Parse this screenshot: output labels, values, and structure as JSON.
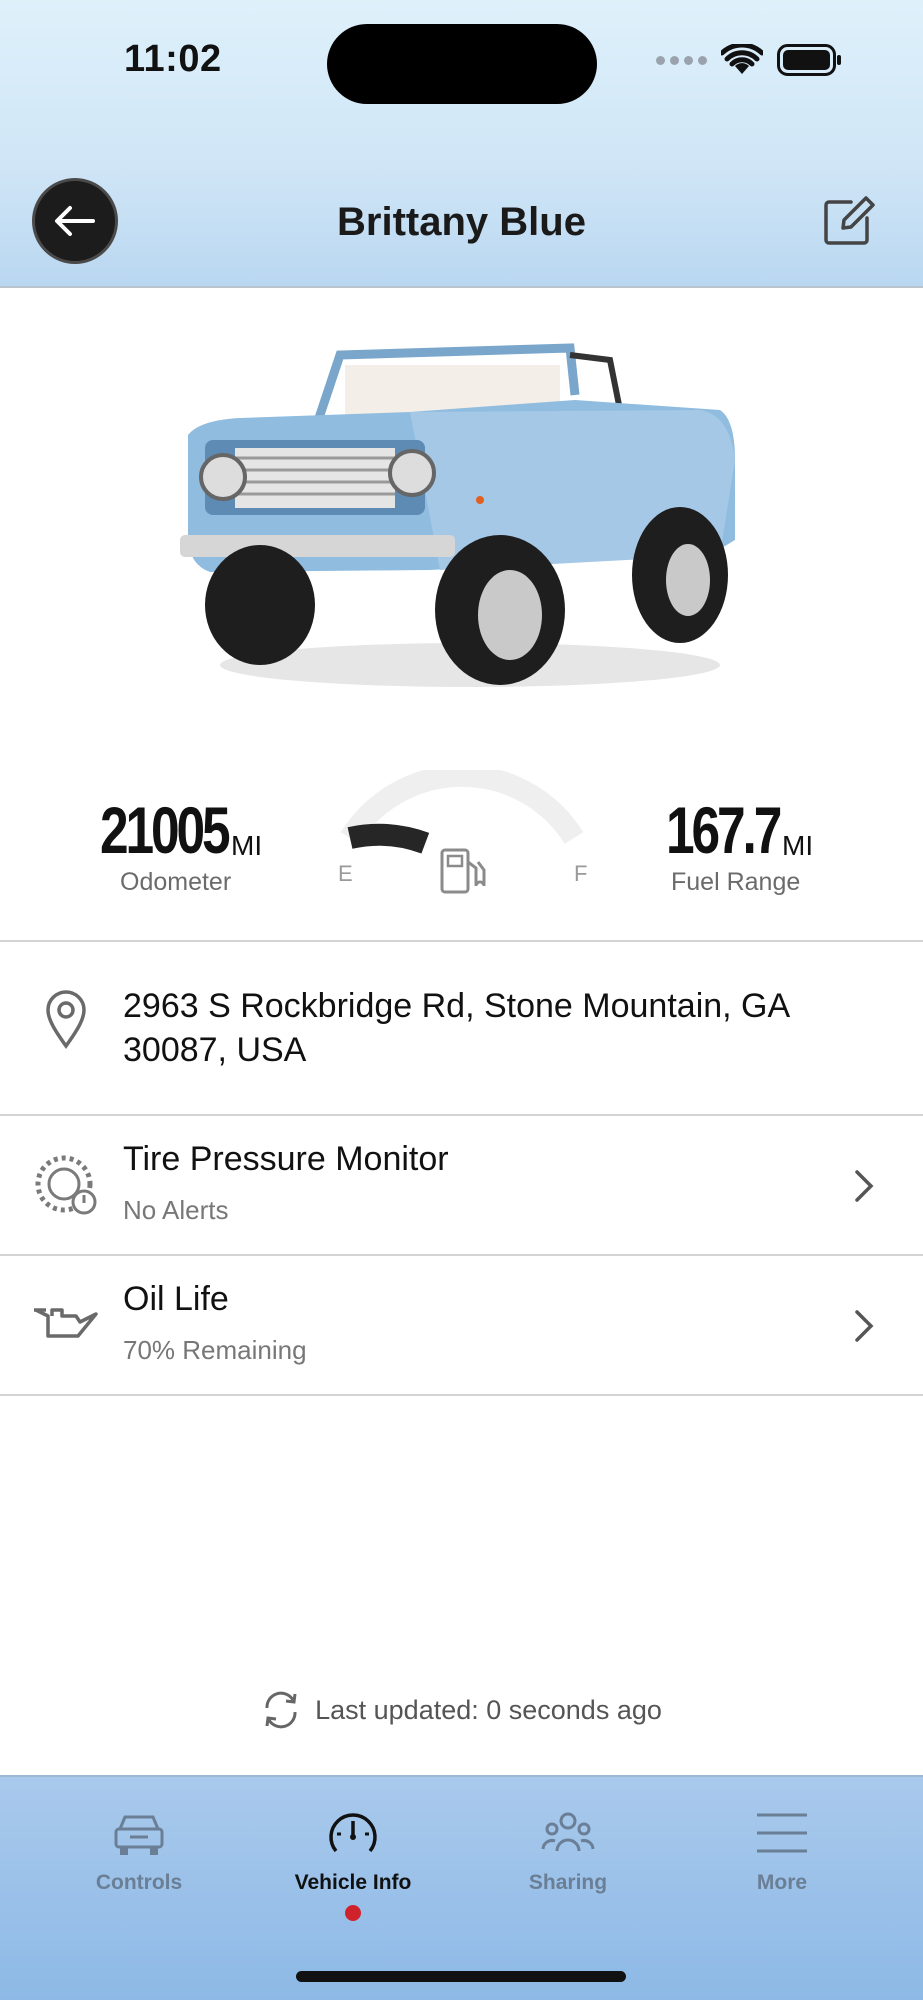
{
  "status_bar": {
    "time": "11:02"
  },
  "header": {
    "title": "Brittany Blue"
  },
  "stats": {
    "odometer_value": "21005",
    "odometer_unit": "MI",
    "odometer_label": "Odometer",
    "fuel_range_value": "167.7",
    "fuel_range_unit": "MI",
    "fuel_range_label": "Fuel Range",
    "fuel_gauge": {
      "empty_label": "E",
      "full_label": "F",
      "level": 0.3
    }
  },
  "location": {
    "address": "2963 S Rockbridge Rd, Stone Mountain, GA 30087, USA"
  },
  "tire_pressure": {
    "title": "Tire Pressure Monitor",
    "status": "No Alerts"
  },
  "oil_life": {
    "title": "Oil Life",
    "status": "70% Remaining"
  },
  "last_updated": "Last updated: 0 seconds ago",
  "tabs": [
    {
      "label": "Controls",
      "icon": "car-icon"
    },
    {
      "label": "Vehicle Info",
      "icon": "speedometer-icon",
      "active": true
    },
    {
      "label": "Sharing",
      "icon": "people-icon"
    },
    {
      "label": "More",
      "icon": "menu-icon"
    }
  ],
  "colors": {
    "accent_dot": "#d0222b",
    "tabbar": "#8db9e6",
    "header": "#cfe5f6"
  }
}
